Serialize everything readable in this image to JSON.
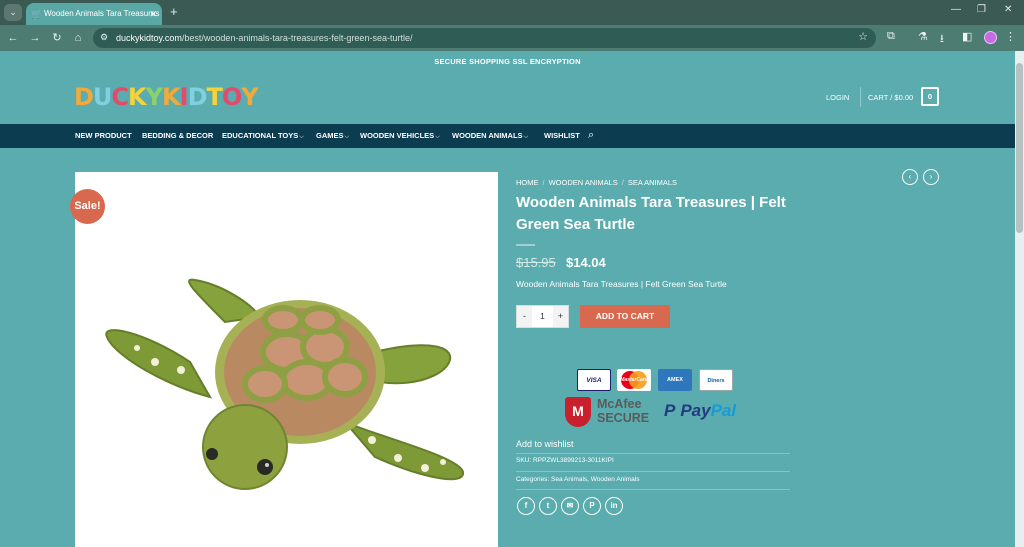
{
  "browser": {
    "tab_title": "Wooden Animals Tara Treasures",
    "new_tab": "+",
    "url_host": "duckykidtoy.com",
    "url_path": "/best/wooden-animals-tara-treasures-felt-green-sea-turtle/"
  },
  "header": {
    "secure_banner": "SECURE SHOPPING SSL ENCRYPTION",
    "logo_letters": [
      "D",
      "U",
      "C",
      "K",
      "Y",
      "K",
      "I",
      "D",
      "T",
      "O",
      "Y"
    ],
    "logo_colors": [
      "#f2a93b",
      "#7fd0e0",
      "#e24b6b",
      "#f7d33a",
      "#8bd26a",
      "#f2a93b",
      "#e24b6b",
      "#7fd0e0",
      "#f7d33a",
      "#e24b6b",
      "#f2a93b"
    ],
    "login": "LOGIN",
    "cart": "CART / $0.00",
    "cart_count": "0"
  },
  "nav": {
    "items": [
      {
        "label": "NEW PRODUCT",
        "chevron": ""
      },
      {
        "label": "BEDDING & DECOR",
        "chevron": ""
      },
      {
        "label": "EDUCATIONAL TOYS",
        "chevron": "⌵"
      },
      {
        "label": "GAMES",
        "chevron": "⌵"
      },
      {
        "label": "WOODEN VEHICLES",
        "chevron": "⌵"
      },
      {
        "label": "WOODEN ANIMALS",
        "chevron": "⌵"
      },
      {
        "label": "WISHLIST",
        "chevron": ""
      }
    ]
  },
  "product": {
    "sale_badge": "Sale!",
    "breadcrumb": [
      "HOME",
      "WOODEN ANIMALS",
      "SEA ANIMALS"
    ],
    "breadcrumb_sep": "/",
    "title": "Wooden Animals Tara Treasures | Felt Green Sea Turtle",
    "price_old": "$15.95",
    "price_new": "$14.04",
    "short_desc": "Wooden Animals Tara Treasures | Felt Green Sea Turtle",
    "qty_minus": "-",
    "qty_value": "1",
    "qty_plus": "+",
    "add_to_cart": "ADD TO CART",
    "wishlist": "Add to wishlist",
    "sku": "SKU: RPPZWL3899213-3011KIPI",
    "categories": "Categories: Sea Animals, Wooden Animals",
    "image_alt": "felt green sea turtle"
  },
  "trust": {
    "cards": [
      "VISA",
      "MasterCard",
      "AMEX",
      "Diners"
    ],
    "mcafee_line1": "McAfee",
    "mcafee_line2": "SECURE",
    "mcafee_mark": "M",
    "paypal_pay": "Pay",
    "paypal_pal": "Pal",
    "paypal_mark": "P"
  },
  "share": {
    "icons": [
      "facebook-icon",
      "twitter-icon",
      "email-icon",
      "pinterest-icon",
      "linkedin-icon"
    ],
    "glyphs": [
      "f",
      "t",
      "✉",
      "P",
      "in"
    ]
  }
}
